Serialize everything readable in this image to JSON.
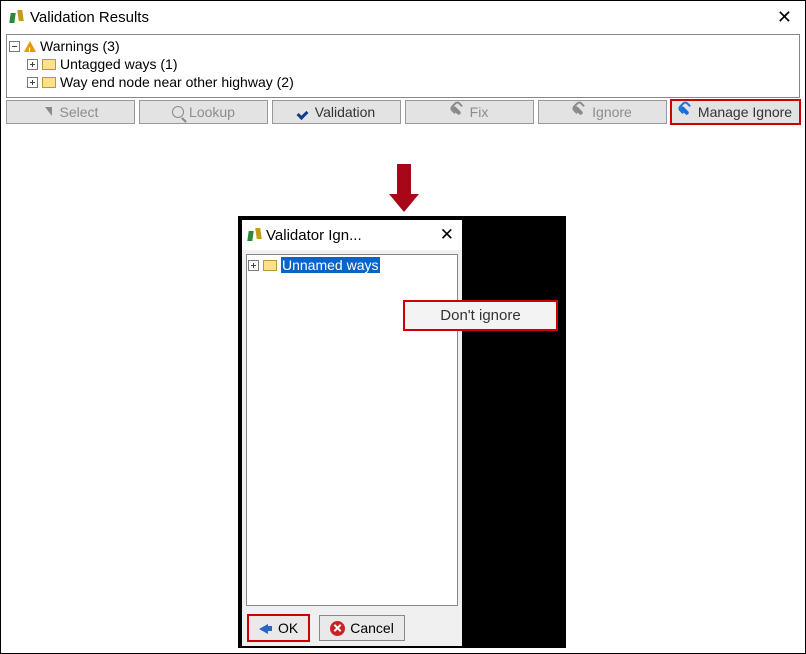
{
  "vr": {
    "title": "Validation Results",
    "root_label": "Warnings (3)",
    "items": [
      {
        "label": "Untagged ways (1)"
      },
      {
        "label": "Way end node near other highway (2)"
      }
    ]
  },
  "toolbar": {
    "select": "Select",
    "lookup": "Lookup",
    "validation": "Validation",
    "fix": "Fix",
    "ignore": "Ignore",
    "manage": "Manage Ignore"
  },
  "modal": {
    "title": "Validator Ign...",
    "tree_item": "Unnamed ways",
    "ctx_item": "Don't ignore",
    "ok": "OK",
    "cancel": "Cancel"
  }
}
